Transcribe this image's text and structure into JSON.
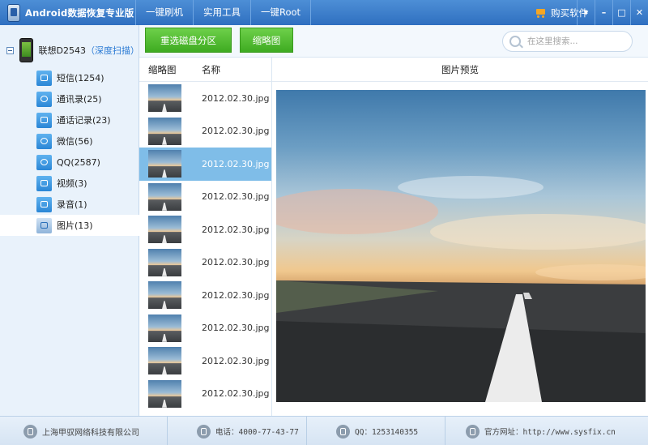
{
  "app": {
    "title": "Android数据恢复专业版",
    "menu": [
      {
        "label": "一键刷机"
      },
      {
        "label": "实用工具"
      },
      {
        "label": "一键Root"
      }
    ],
    "buy_label": "购买软件",
    "window_buttons": {
      "menu": "▾",
      "minimize": "–",
      "maximize": "□",
      "close": "✕"
    }
  },
  "sidebar": {
    "device_name": "联想D2543",
    "deep_scan_label": "（深度扫描）",
    "items": [
      {
        "label": "短信(1254)",
        "icon": "sms-icon"
      },
      {
        "label": "通讯录(25)",
        "icon": "contacts-icon"
      },
      {
        "label": "通话记录(23)",
        "icon": "call-log-icon"
      },
      {
        "label": "微信(56)",
        "icon": "wechat-icon"
      },
      {
        "label": "QQ(2587)",
        "icon": "qq-icon"
      },
      {
        "label": "视频(3)",
        "icon": "video-icon"
      },
      {
        "label": "录音(1)",
        "icon": "recording-icon"
      },
      {
        "label": "图片(13)",
        "icon": "picture-icon"
      }
    ],
    "active_index": 7
  },
  "toolbar": {
    "rescan_label": "重选磁盘分区",
    "thumbnail_label": "缩略图",
    "search_placeholder": "在这里搜索..."
  },
  "file_list": {
    "columns": {
      "thumb": "缩略图",
      "name": "名称"
    },
    "rows": [
      {
        "name": "2012.02.30.jpg"
      },
      {
        "name": "2012.02.30.jpg"
      },
      {
        "name": "2012.02.30.jpg"
      },
      {
        "name": "2012.02.30.jpg"
      },
      {
        "name": "2012.02.30.jpg"
      },
      {
        "name": "2012.02.30.jpg"
      },
      {
        "name": "2012.02.30.jpg"
      },
      {
        "name": "2012.02.30.jpg"
      },
      {
        "name": "2012.02.30.jpg"
      },
      {
        "name": "2012.02.30.jpg"
      }
    ],
    "selected_index": 2
  },
  "preview": {
    "title": "图片预览"
  },
  "statusbar": {
    "company": "上海甲驭网络科技有限公司",
    "phone": "电话：4000-77-43-77",
    "qq": "QQ：1253140355",
    "website": "官方网址：http://www.sysfix.cn"
  },
  "colors": {
    "titlebar": "#3a7dcb",
    "button_green": "#4fbd2f",
    "selected_row": "#7fbde8",
    "sidebar_bg": "#e9f2fb"
  }
}
